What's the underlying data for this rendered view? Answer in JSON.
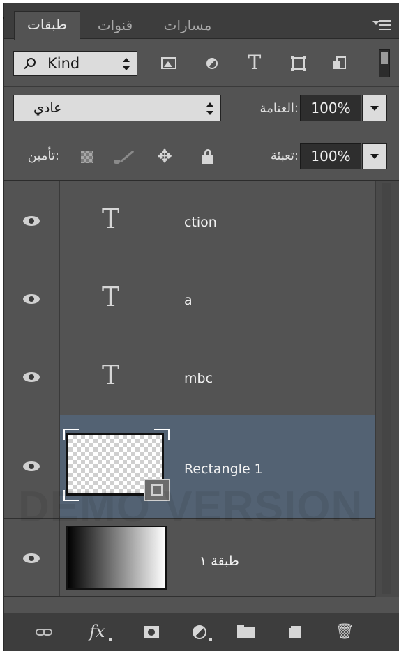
{
  "panel": {
    "tabs": [
      {
        "label": "طبقات",
        "active": true
      },
      {
        "label": "قنوات",
        "active": false
      },
      {
        "label": "مسارات",
        "active": false
      }
    ],
    "menu_icon": "panel-menu-icon"
  },
  "filter": {
    "kind_label": "Kind",
    "icons": [
      "pixel-filter-icon",
      "adjustment-filter-icon",
      "type-filter-icon",
      "shape-filter-icon",
      "smart-object-filter-icon"
    ],
    "filter_toggle": "filter-toggle"
  },
  "blend": {
    "mode": "عادي",
    "opacity_label": ":العتامة",
    "opacity_value": "100%"
  },
  "lock": {
    "label": ":تأمين",
    "fill_label": ":تعبئة",
    "fill_value": "100%",
    "icons": [
      "lock-transparent-icon",
      "lock-paint-icon",
      "lock-move-icon",
      "lock-all-icon"
    ]
  },
  "layers": [
    {
      "name": "ction",
      "type": "text",
      "visible": true,
      "selected": false
    },
    {
      "name": "a",
      "type": "text",
      "visible": true,
      "selected": false
    },
    {
      "name": "mbc",
      "type": "text",
      "visible": true,
      "selected": false
    },
    {
      "name": "Rectangle 1",
      "type": "shape",
      "visible": true,
      "selected": true
    },
    {
      "name": "طبقة ١",
      "type": "gradient",
      "visible": true,
      "selected": false
    }
  ],
  "footer": {
    "fx_label": "fx",
    "icons": [
      "link-layers-icon",
      "fx-icon",
      "add-mask-icon",
      "adjustment-layer-icon",
      "group-folder-icon",
      "new-layer-icon",
      "trash-icon"
    ]
  },
  "watermark": "DEMO VERSION",
  "colors": {
    "panel_bg": "#535353",
    "header_bg": "#3d3d3d",
    "selected_row": "#536273",
    "text": "#d6d6d6"
  }
}
